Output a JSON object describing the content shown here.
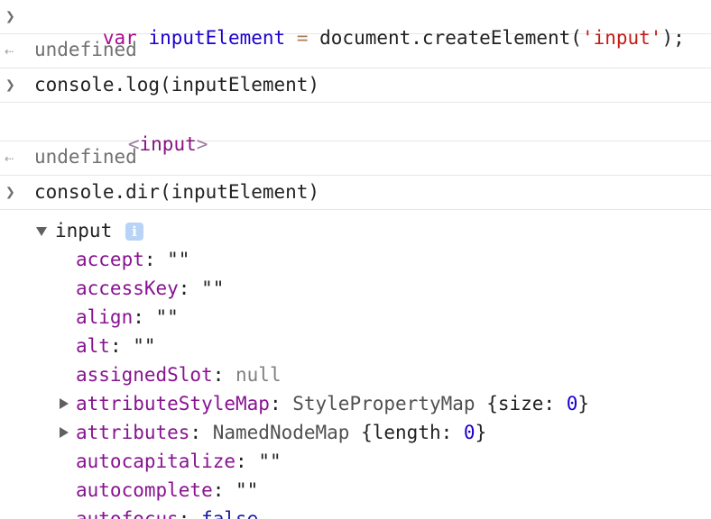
{
  "entries": {
    "cmd1": {
      "prompt_icon": "chevron-right-icon",
      "keyword": "var",
      "var_name": "inputElement",
      "operator": "=",
      "call": "document.createElement(",
      "arg": "'input'",
      "tail": ");"
    },
    "ret1": {
      "icon": "return-arrow-icon",
      "text": "undefined"
    },
    "cmd2": {
      "prompt_icon": "chevron-right-icon",
      "text": "console.log(inputElement)"
    },
    "log_output": {
      "open": "<",
      "tag": "input",
      "close": ">"
    },
    "ret2": {
      "icon": "return-arrow-icon",
      "text": "undefined"
    },
    "cmd3": {
      "prompt_icon": "chevron-right-icon",
      "text": "console.dir(inputElement)"
    },
    "dir_output": {
      "root_label": "input",
      "info_badge": "i",
      "properties": [
        {
          "name": "accept",
          "value": "\"\"",
          "kind": "string"
        },
        {
          "name": "accessKey",
          "value": "\"\"",
          "kind": "string"
        },
        {
          "name": "align",
          "value": "\"\"",
          "kind": "string"
        },
        {
          "name": "alt",
          "value": "\"\"",
          "kind": "string"
        },
        {
          "name": "assignedSlot",
          "value": "null",
          "kind": "null"
        },
        {
          "name": "attributeStyleMap",
          "value_prefix": "StylePropertyMap",
          "value_body": "{size: ",
          "value_num": "0",
          "value_end": "}",
          "kind": "object",
          "expandable": true
        },
        {
          "name": "attributes",
          "value_prefix": "NamedNodeMap",
          "value_body": "{length: ",
          "value_num": "0",
          "value_end": "}",
          "kind": "object",
          "expandable": true
        },
        {
          "name": "autocapitalize",
          "value": "\"\"",
          "kind": "string"
        },
        {
          "name": "autocomplete",
          "value": "\"\"",
          "kind": "string"
        },
        {
          "name": "autofocus",
          "value": "false",
          "kind": "bool"
        }
      ]
    }
  },
  "colors": {
    "keyword": "#aa0d91",
    "property": "#881391",
    "string_literal": "#c41a16",
    "number": "#1c00cf",
    "info_badge_bg": "#b9d3f7"
  }
}
